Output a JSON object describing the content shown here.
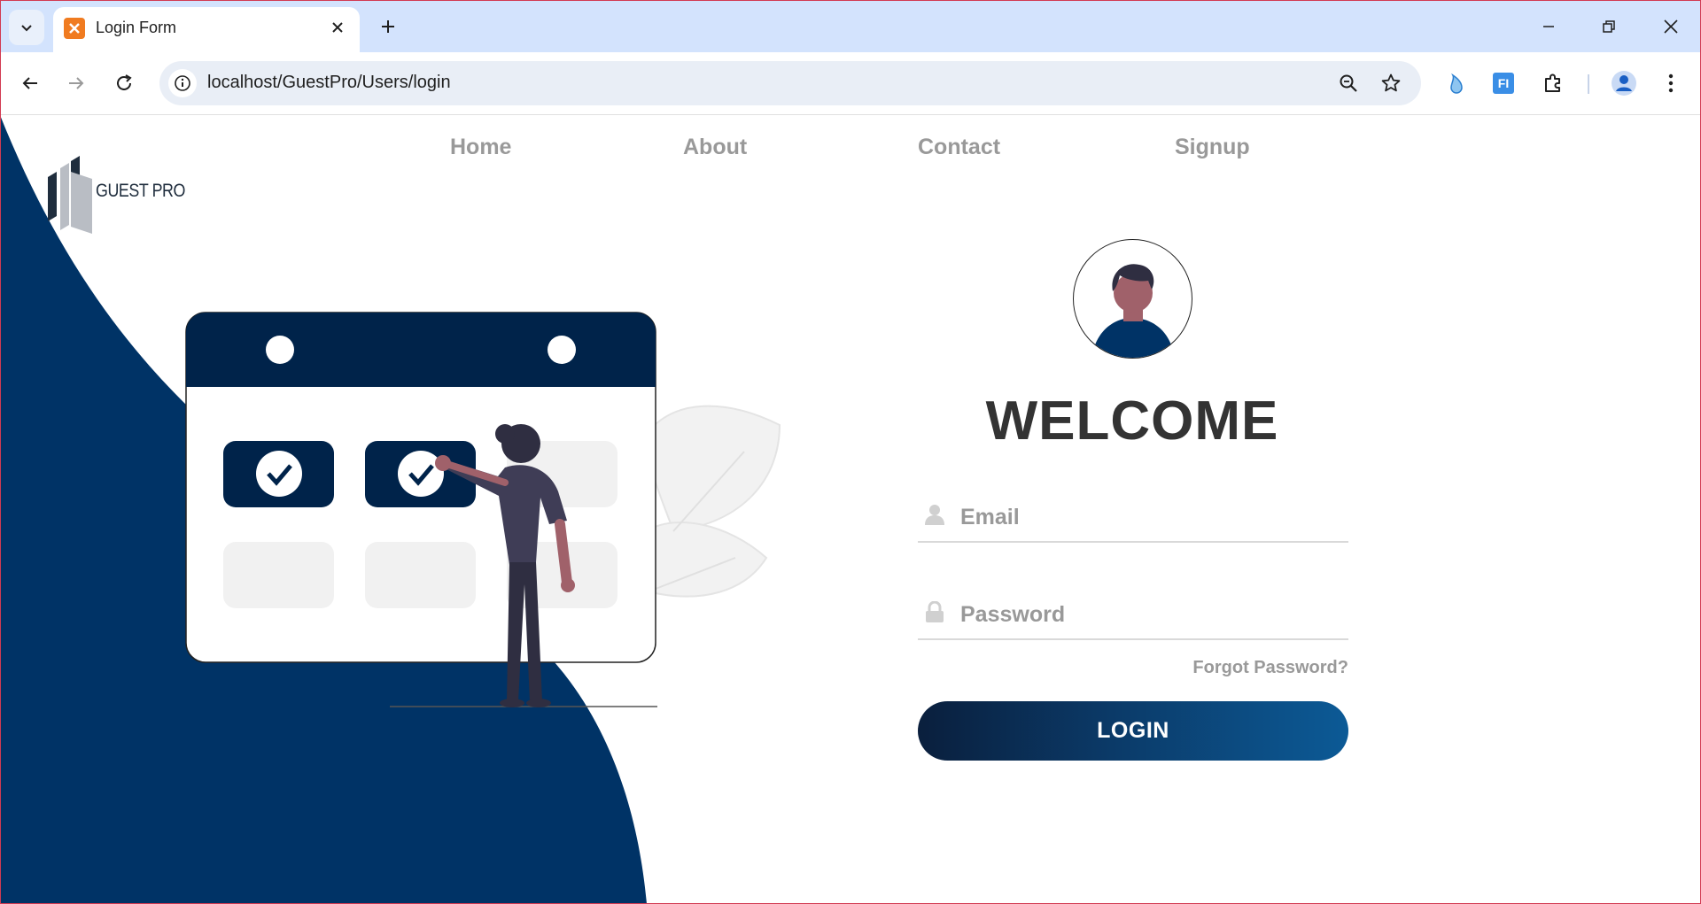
{
  "browser": {
    "tab_title": "Login Form",
    "url": "localhost/GuestPro/Users/login"
  },
  "site": {
    "logo_text": "GUEST PRO",
    "nav": [
      "Home",
      "About",
      "Contact",
      "Signup"
    ]
  },
  "login": {
    "heading": "WELCOME",
    "email_placeholder": "Email",
    "password_placeholder": "Password",
    "forgot_label": "Forgot Password?",
    "login_label": "LOGIN"
  },
  "colors": {
    "brand_navy": "#003366",
    "calendar_dark": "#00234a",
    "accent_gradient_start": "#0a1f3d",
    "accent_gradient_end": "#0c5a96"
  }
}
